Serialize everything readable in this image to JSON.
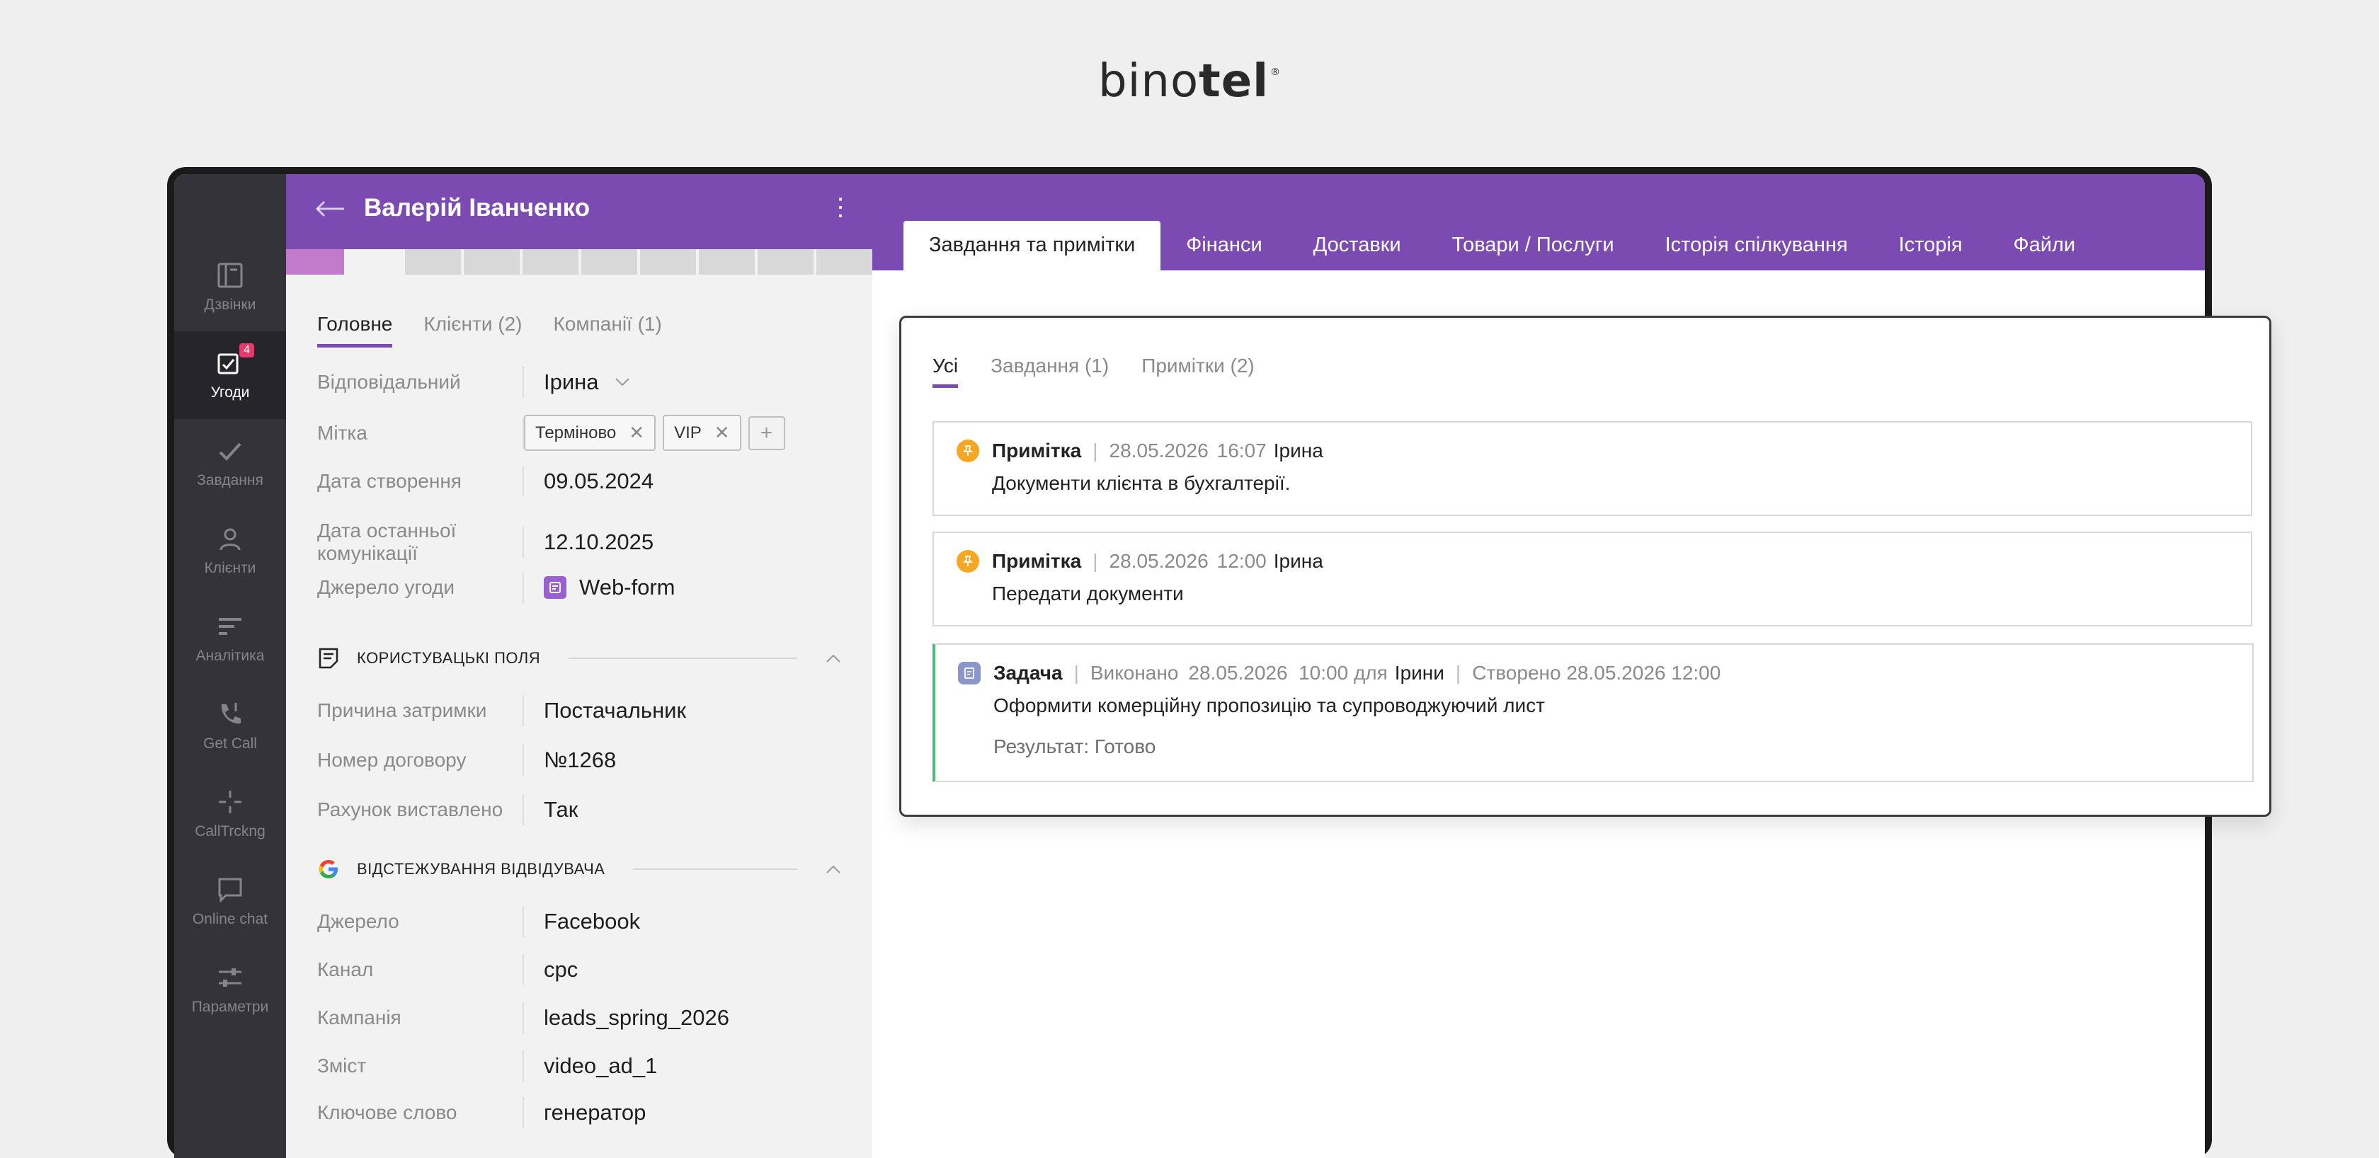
{
  "brand": {
    "name_regular": "bino",
    "name_bold": "tel",
    "mark": "®"
  },
  "nav": {
    "items": [
      {
        "label": "Дзвінки",
        "icon": "calls-icon"
      },
      {
        "label": "Угоди",
        "icon": "deals-icon",
        "badge": "4",
        "active": true
      },
      {
        "label": "Завдання",
        "icon": "tasks-icon"
      },
      {
        "label": "Клієнти",
        "icon": "clients-icon"
      },
      {
        "label": "Аналітика",
        "icon": "analytics-icon"
      },
      {
        "label": "Get Call",
        "icon": "getcall-icon"
      },
      {
        "label": "CallTrckng",
        "icon": "calltracking-icon"
      },
      {
        "label": "Online chat",
        "icon": "chat-icon"
      },
      {
        "label": "Параметри",
        "icon": "settings-icon"
      }
    ]
  },
  "deal": {
    "title": "Валерій Іванченко",
    "menu": "⋮",
    "tabs": [
      "Головне",
      "Клієнти (2)",
      "Компанії (1)"
    ],
    "fields": {
      "owner": {
        "label": "Відповідальний",
        "value": "Ірина"
      },
      "tags": {
        "label": "Мітка",
        "values": [
          "Терміново",
          "VIP"
        ],
        "add": "+"
      },
      "created": {
        "label": "Дата створення",
        "value": "09.05.2024"
      },
      "last_comm": {
        "label": "Дата останньої комунікації",
        "value": "12.10.2025"
      },
      "source": {
        "label": "Джерело угоди",
        "value": "Web-form"
      }
    },
    "custom": {
      "title": "КОРИСТУВАЦЬКІ ПОЛЯ",
      "rows": [
        {
          "label": "Причина затримки",
          "value": "Постачальник"
        },
        {
          "label": "Номер договору",
          "value": "№1268"
        },
        {
          "label": "Рахунок виставлено",
          "value": "Так"
        }
      ]
    },
    "tracking": {
      "title": "ВІДСТЕЖУВАННЯ ВІДВІДУВАЧА",
      "rows": [
        {
          "label": "Джерело",
          "value": "Facebook"
        },
        {
          "label": "Канал",
          "value": "cpc"
        },
        {
          "label": "Кампанія",
          "value": "leads_spring_2026"
        },
        {
          "label": "Зміст",
          "value": "video_ad_1"
        },
        {
          "label": "Ключове слово",
          "value": "генератор"
        }
      ]
    }
  },
  "right": {
    "tabs": [
      "Завдання та примітки",
      "Фінанси",
      "Доставки",
      "Товари / Послуги",
      "Історія спілкування",
      "Історія",
      "Файли"
    ],
    "card": {
      "tabs": [
        "Усі",
        "Завдання (1)",
        "Примітки (2)"
      ],
      "items": [
        {
          "kind": "Примітка",
          "date": "28.05.2026",
          "time": "16:07",
          "who": "Ірина",
          "text": "Документи клієнта в бухгалтерії."
        },
        {
          "kind": "Примітка",
          "date": "28.05.2026",
          "time": "12:00",
          "who": "Ірина",
          "text": "Передати документи"
        },
        {
          "kind": "Задача",
          "status": "Виконано",
          "due": "28.05.2026  10:00 для",
          "who": "Ірини",
          "created": "Створено 28.05.2026 12:00",
          "text": "Оформити комерційну пропозицію та супроводжуючий лист",
          "result": "Результат: Готово"
        }
      ]
    }
  },
  "colors": {
    "accent": "#7b4bb1",
    "nav": "#34333a",
    "note": "#f5a623",
    "task": "#8a97c8",
    "done_border": "#4dbd7b",
    "badge": "#e23b6c"
  }
}
